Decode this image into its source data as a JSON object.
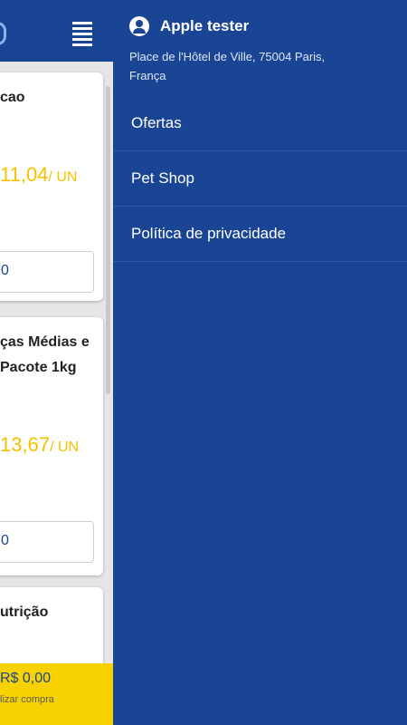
{
  "background": {
    "cards": [
      {
        "title": "cao",
        "price": "11,04",
        "unit": "/ UN",
        "qty": "0"
      },
      {
        "title": "ças Médias e\nPacote 1kg",
        "price": "13,67",
        "unit": "/ UN",
        "qty": "0"
      },
      {
        "title": "utrição"
      }
    ],
    "cart": {
      "total": "R$ 0,00",
      "subtitle": "lizar compra"
    }
  },
  "drawer": {
    "user_name": "Apple tester",
    "address": "Place de l'Hôtel de Ville, 75004 Paris, França",
    "menu": [
      {
        "label": "Ofertas"
      },
      {
        "label": "Pet Shop"
      },
      {
        "label": "Política de privacidade"
      }
    ]
  },
  "colors": {
    "primary": "#1a4594",
    "accent": "#f7d200",
    "price": "#f2c200"
  }
}
